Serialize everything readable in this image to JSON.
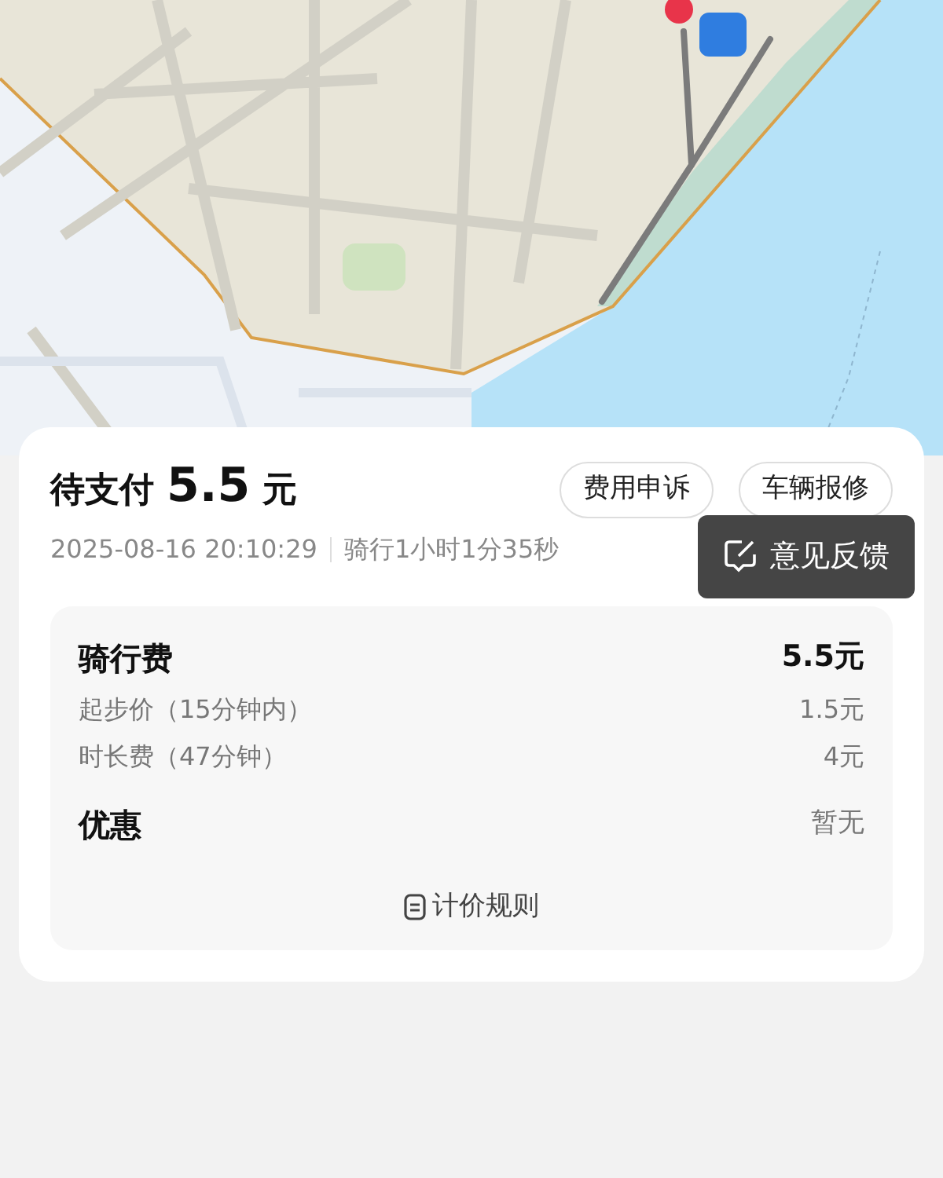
{
  "order": {
    "status_label": "待支付",
    "amount": "5.5",
    "unit": "元",
    "time": "2025-08-16 20:10:29",
    "duration": "骑行1小时1分35秒"
  },
  "actions": [
    "费用申诉",
    "车辆报修"
  ],
  "tooltip": {
    "text": "意见反馈"
  },
  "fees": [
    {
      "kind": "total",
      "label": "骑行费",
      "value": "5.5元"
    },
    {
      "kind": "detail",
      "label": "起步价（15分钟内）",
      "value": "1.5元"
    },
    {
      "kind": "detail",
      "label": "时长费（47分钟）",
      "value": "4元"
    },
    {
      "kind": "discount",
      "label": "优惠",
      "value": "暂无"
    }
  ],
  "rules_link": "计价规则"
}
